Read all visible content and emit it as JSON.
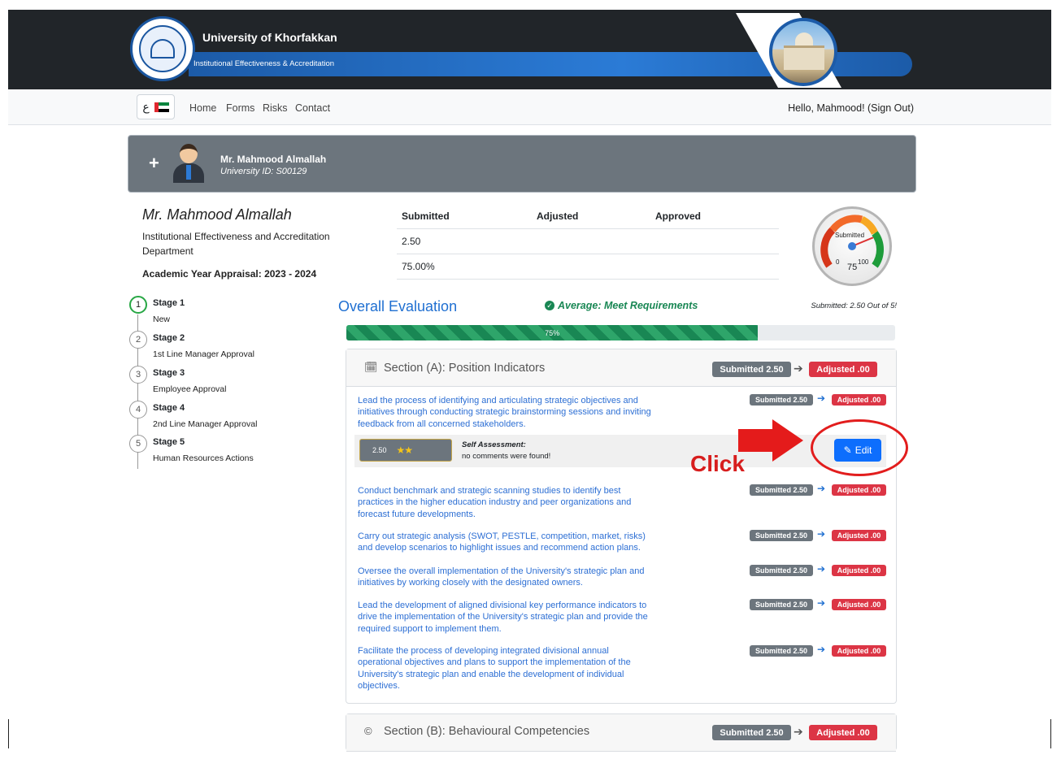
{
  "header": {
    "university_name": "University of Khorfakkan",
    "department_banner": "Institutional Effectiveness & Accreditation"
  },
  "nav": {
    "lang_label": "ع",
    "links": [
      "Home",
      "Forms",
      "Risks",
      "Contact"
    ],
    "greeting": "Hello, Mahmood! (Sign Out)"
  },
  "employee_card": {
    "name": "Mr. Mahmood Almallah",
    "university_id": "University ID:  S00129"
  },
  "profile": {
    "name": "Mr. Mahmood Almallah",
    "department": "Institutional Effectiveness and Accreditation Department",
    "academic_year": "Academic Year Appraisal:  2023 - 2024"
  },
  "scores": {
    "headers": [
      "Submitted",
      "Adjusted",
      "Approved"
    ],
    "rows": [
      [
        "2.50",
        "",
        ""
      ],
      [
        "75.00%",
        "",
        ""
      ]
    ]
  },
  "gauge": {
    "label": "Submitted",
    "min": "0",
    "max": "100",
    "value": "75",
    "fraction": 0.75
  },
  "stages": [
    {
      "title": "Stage 1",
      "subtitle": "New",
      "number": "1"
    },
    {
      "title": "Stage 2",
      "subtitle": "1st Line Manager Approval",
      "number": "2"
    },
    {
      "title": "Stage 3",
      "subtitle": "Employee Approval",
      "number": "3"
    },
    {
      "title": "Stage 4",
      "subtitle": "2nd Line Manager Approval",
      "number": "4"
    },
    {
      "title": "Stage 5",
      "subtitle": "Human Resources Actions",
      "number": "5"
    }
  ],
  "overall": {
    "title": "Overall Evaluation",
    "average": "Average: Meet Requirements",
    "submitted_out": "Submitted: 2.50 Out of 5!",
    "progress_label": "75%",
    "progress": 0.75
  },
  "section_a": {
    "title": "Section (A): Position Indicators",
    "submitted_badge": "Submitted  2.50",
    "adjusted_badge": "Adjusted  .00",
    "indicators": [
      "Lead the process of identifying and articulating strategic objectives and initiatives through conducting strategic brainstorming sessions and inviting feedback from all concerned stakeholders.",
      "Conduct benchmark and strategic scanning studies to identify best practices in the higher education industry and peer organizations and forecast future developments.",
      "Carry out strategic analysis (SWOT, PESTLE, competition, market, risks) and develop scenarios to highlight issues and recommend action plans.",
      "Oversee the overall implementation of the University's strategic plan and initiatives by working closely with the designated owners.",
      "Lead the development of aligned divisional key performance indicators to drive the implementation of the University's strategic plan and provide the required support to implement them.",
      "Facilitate the process of developing integrated divisional annual operational objectives and plans to support the implementation of the University's strategic plan and enable the development of individual objectives."
    ],
    "indicator_submitted": "Submitted  2.50",
    "indicator_adjusted": "Adjusted  .00",
    "self_assessment": {
      "rating": "2.50",
      "stars": "★★",
      "title": "Self Assessment:",
      "comment": "no comments were found!"
    },
    "edit_label": "Edit"
  },
  "section_b": {
    "title": "Section (B): Behavioural Competencies",
    "submitted_badge": "Submitted  2.50",
    "adjusted_badge": "Adjusted  .00"
  },
  "annotation": {
    "click_label": "Click"
  },
  "colors": {
    "accent": "#0d6efd",
    "success": "#198754",
    "danger": "#dc3545",
    "muted": "#6c757d"
  }
}
